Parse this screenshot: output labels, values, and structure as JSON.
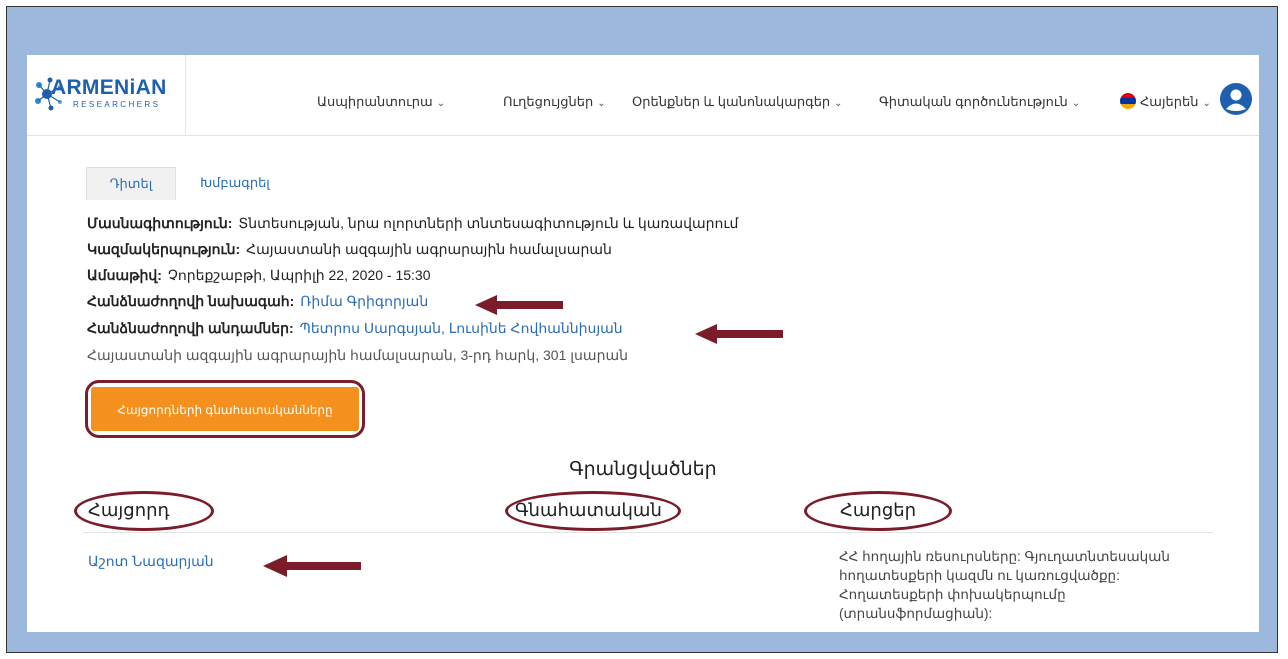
{
  "brand": {
    "title": "ARMENiAN",
    "subtitle": "RESEARCHERS"
  },
  "nav": {
    "items": [
      {
        "label": "Ասպիրանտուրա"
      },
      {
        "label": "Ուղեցույցներ"
      },
      {
        "label": "Օրենքներ և կանոնակարգեր"
      },
      {
        "label": "Գիտական գործունեություն"
      }
    ],
    "language": "Հայերեն"
  },
  "tabs": {
    "view": "Դիտել",
    "edit": "Խմբագրել"
  },
  "info": {
    "specialty_label": "Մասնագիտություն:",
    "specialty_value": "Տնտեսության, նրա ոլորտների տնտեսագիտություն և կառավարում",
    "organization_label": "Կազմակերպություն:",
    "organization_value": "Հայաստանի ազգային ագրարային համալսարան",
    "date_label": "Ամսաթիվ:",
    "date_value": "Չորեքշաբթի, Ապրիլի 22, 2020 - 15:30",
    "chair_label": "Հանձնաժողովի նախագահ:",
    "chair_value": "Ռիմա Գրիգորյան",
    "members_label": "Հանձնաժողովի անդամներ:",
    "members_value": "Պետրոս Սարգսյան, Լուսինե Հովհաննիսյան",
    "address": "Հայաստանի ազգային ագրարային համալսարան, 3-րդ հարկ, 301 լսարան"
  },
  "button": {
    "label": "Հայցորդների գնահատականները"
  },
  "records": {
    "title": "Գրանցվածներ",
    "columns": [
      "Հայցորդ",
      "Գնահատական",
      "Հարցեր"
    ],
    "rows": [
      {
        "applicant": "Աշոտ Նազարյան",
        "grade": "",
        "questions": "ՀՀ հողային ռեսուրսները: Գյուղատնտեսական հողատեսքերի կազմն ու կառուցվածքը: Հողատեսքերի փոխակերպումը (տրանսֆորմացիան):"
      }
    ]
  },
  "colors": {
    "frame": "#9cb8dc",
    "link": "#2a6db5",
    "button": "#f4901e",
    "annotation": "#7a1c2a",
    "brand": "#1f5fb0"
  },
  "icons": [
    "user-avatar-icon",
    "armenian-flag-icon",
    "chevron-down-icon",
    "annotation-arrow-icon",
    "logo-icon"
  ]
}
